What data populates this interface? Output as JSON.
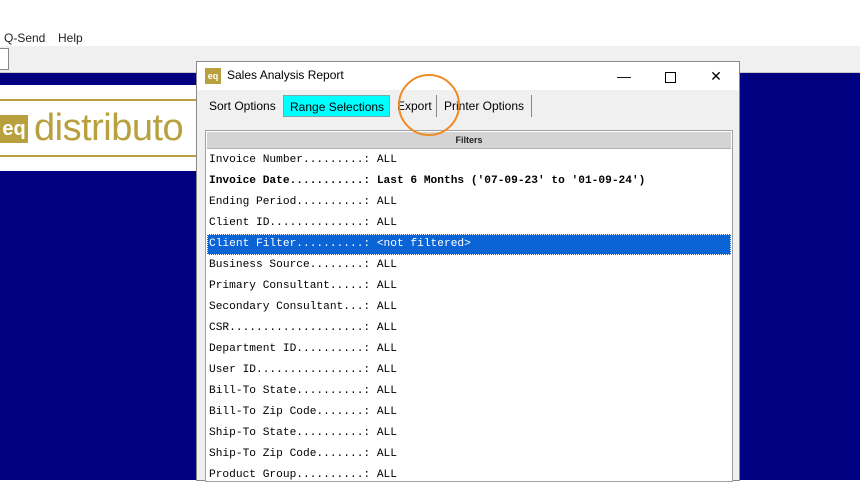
{
  "app": {
    "menu": [
      "Q-Send",
      "Help"
    ],
    "logo_badge": "eq",
    "logo_text": "distributo"
  },
  "dialog": {
    "title": "Sales Analysis Report",
    "icon_text": "eq",
    "controls": {
      "minimize": "—",
      "maximize": "",
      "close": "✕"
    },
    "tabs": [
      {
        "label": "Sort Options",
        "active": false
      },
      {
        "label": "Range Selections",
        "active": true
      },
      {
        "label": "Export",
        "active": false
      },
      {
        "label": "Printer Options",
        "active": false
      }
    ],
    "filters_header": "Filters",
    "filters": [
      {
        "label": "Invoice Number.........: ",
        "value": "ALL"
      },
      {
        "label": "Invoice Date...........: ",
        "value": "Last 6 Months ('07-09-23' to '01-09-24')"
      },
      {
        "label": "Ending Period..........: ",
        "value": "ALL"
      },
      {
        "label": "Client ID..............: ",
        "value": "ALL"
      },
      {
        "label": "Client Filter..........: ",
        "value": "<not filtered>"
      },
      {
        "label": "Business Source........: ",
        "value": "ALL"
      },
      {
        "label": "Primary Consultant.....: ",
        "value": "ALL"
      },
      {
        "label": "Secondary Consultant...: ",
        "value": "ALL"
      },
      {
        "label": "CSR....................: ",
        "value": "ALL"
      },
      {
        "label": "Department ID..........: ",
        "value": "ALL"
      },
      {
        "label": "User ID................: ",
        "value": "ALL"
      },
      {
        "label": "Bill-To State..........: ",
        "value": "ALL"
      },
      {
        "label": "Bill-To Zip Code.......: ",
        "value": "ALL"
      },
      {
        "label": "Ship-To State..........: ",
        "value": "ALL"
      },
      {
        "label": "Ship-To Zip Code.......: ",
        "value": "ALL"
      },
      {
        "label": "Product Group..........: ",
        "value": "ALL"
      }
    ],
    "selected_index": 4,
    "bold_index": 1
  },
  "colors": {
    "desktop_blue": "#000080",
    "tab_active": "#00ffff",
    "selection": "#0a64d6",
    "highlight_circle": "#f08a24",
    "brand_gold": "#b9a03f"
  }
}
